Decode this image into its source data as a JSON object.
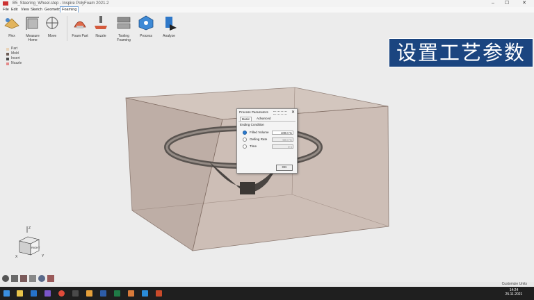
{
  "window": {
    "title": "B5_Steering_Wheel.step - Inspire PolyFoam 2021.2"
  },
  "menu": [
    "File",
    "Edit",
    "View",
    "Sketch",
    "Geometry",
    "Foaming"
  ],
  "active_menu": "Foaming",
  "ribbon": [
    {
      "label": "Flex",
      "icon": "flex-icon"
    },
    {
      "label": "Measure\nHome",
      "icon": "measure-icon"
    },
    {
      "label": "Move",
      "icon": "move-icon"
    },
    {
      "label": "Foam Part",
      "icon": "foam-part-icon"
    },
    {
      "label": "Nozzle",
      "icon": "nozzle-icon"
    },
    {
      "label": "Tooling\nFoaming",
      "icon": "tooling-icon"
    },
    {
      "label": "Process",
      "icon": "process-icon"
    },
    {
      "label": "Analyze",
      "icon": "analyze-icon"
    }
  ],
  "legend": [
    {
      "label": "Part",
      "color": "#e9d3b8"
    },
    {
      "label": "Mold",
      "color": "#6f5f58"
    },
    {
      "label": "Insert",
      "color": "#4a4a4a"
    },
    {
      "label": "Nozzle",
      "color": "#e48a8a"
    }
  ],
  "banner": {
    "text": "设置工艺参数"
  },
  "dialog": {
    "title": "Process Parameters",
    "tabs": [
      "Basic",
      "Advanced"
    ],
    "selected_tab": "Basic",
    "group": "Ending Condition",
    "options": [
      {
        "label": "Filled Volume",
        "value": "100.0 %",
        "selected": true
      },
      {
        "label": "Gelling Rate",
        "value": "50.0 %",
        "selected": false
      },
      {
        "label": "Time",
        "value": "0 s",
        "selected": false
      }
    ],
    "ok": "OK"
  },
  "viewcube": {
    "face": "RIGHT",
    "axes": [
      "Z",
      "X",
      "Y"
    ]
  },
  "status": {
    "text": "Customize Units"
  },
  "taskbar": {
    "time": "14:24",
    "date": "25.11.2021"
  }
}
